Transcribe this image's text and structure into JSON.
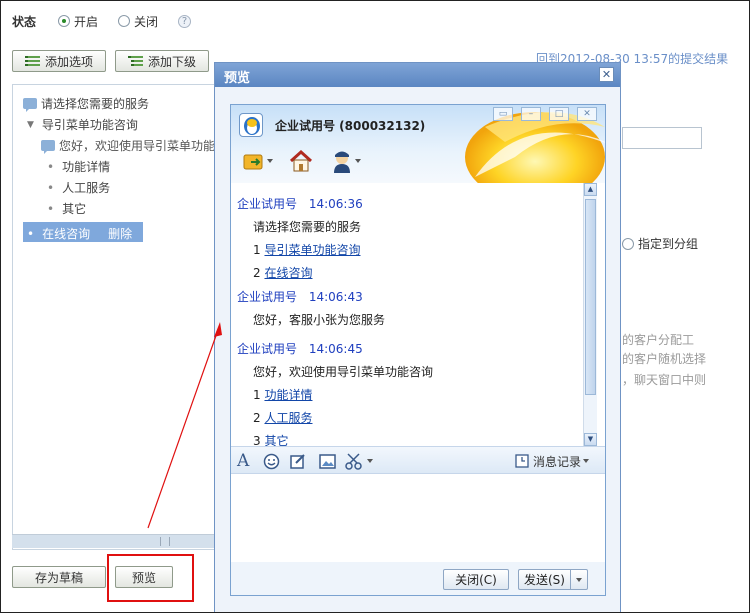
{
  "status": {
    "label": "状态",
    "option_on": "开启",
    "option_off": "关闭",
    "selected": "开启",
    "help": "?"
  },
  "toolbar": {
    "add_option": "添加选项",
    "add_child": "添加下级"
  },
  "history_link": "回到2012-08-30 13:57的提交结果",
  "tree": {
    "root": "请选择您需要的服务",
    "menu_parent": "导引菜单功能咨询",
    "menu_greeting": "您好，欢迎使用导引菜单功能",
    "children": [
      "功能详情",
      "人工服务",
      "其它"
    ],
    "selected_item": "在线咨询",
    "delete_label": "删除"
  },
  "right_panel": {
    "radio_label": "指定到分组",
    "text_lines": [
      "的客户分配工",
      "的客户随机选择",
      "，聊天窗口中则"
    ]
  },
  "bottom": {
    "save_draft": "存为草稿",
    "preview": "预览"
  },
  "dialog": {
    "title": "预览",
    "close": "✕"
  },
  "chat": {
    "account_name": "企业试用号 (800032132)",
    "messages": [
      {
        "sender": "企业试用号",
        "time": "14:06:36",
        "text": "请选择您需要的服务"
      },
      {
        "num": "1",
        "link": "导引菜单功能咨询"
      },
      {
        "num": "2",
        "link": "在线咨询"
      },
      {
        "sender": "企业试用号",
        "time": "14:06:43",
        "text": "您好，客服小张为您服务"
      },
      {
        "sender": "企业试用号",
        "time": "14:06:45",
        "text": "您好，欢迎使用导引菜单功能咨询"
      },
      {
        "num": "1",
        "link": "功能详情"
      },
      {
        "num": "2",
        "link": "人工服务"
      },
      {
        "num": "3",
        "link": "其它"
      }
    ],
    "history_button": "消息记录",
    "close_button": "关闭(C)",
    "send_button": "发送(S)"
  },
  "colors": {
    "accent": "#5b86c2",
    "highlight": "#e01010",
    "link": "#1246a8",
    "sender": "#1f3fbf"
  }
}
